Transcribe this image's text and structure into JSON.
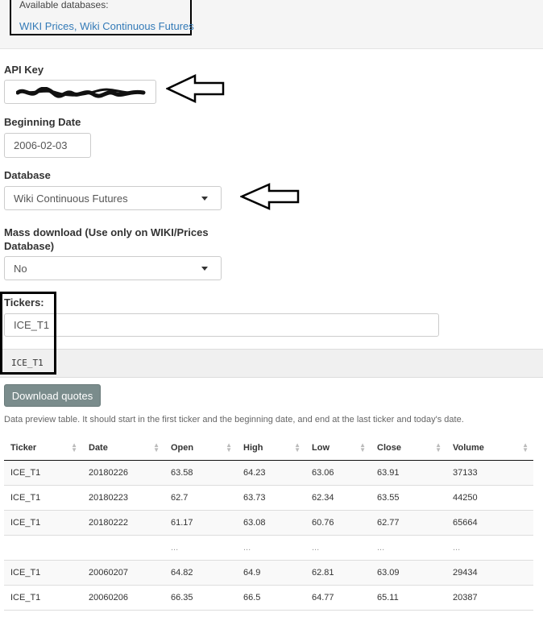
{
  "databases": {
    "title": "Available databases:",
    "list": "WIKI Prices, Wiki Continuous Futures"
  },
  "api_key": {
    "label": "API Key",
    "value_redacted": "redacted-scribble"
  },
  "beginning_date": {
    "label": "Beginning Date",
    "value": "2006-02-03"
  },
  "database": {
    "label": "Database",
    "selected": "Wiki Continuous Futures"
  },
  "mass_download": {
    "label_line1": "Mass download (Use only on WIKI/Prices",
    "label_line2": "Database)",
    "selected": "No"
  },
  "tickers": {
    "label": "Tickers:",
    "input_value": "ICE_T1",
    "token": "ICE_T1"
  },
  "download_button": "Download quotes",
  "preview_note": "Data preview table. It should start in the first ticker and the beginning date, and end at the last ticker and today's date.",
  "table": {
    "headers": [
      "Ticker",
      "Date",
      "Open",
      "High",
      "Low",
      "Close",
      "Volume"
    ],
    "rows": [
      [
        "ICE_T1",
        "20180226",
        "63.58",
        "64.23",
        "63.06",
        "63.91",
        "37133"
      ],
      [
        "ICE_T1",
        "20180223",
        "62.7",
        "63.73",
        "62.34",
        "63.55",
        "44250"
      ],
      [
        "ICE_T1",
        "20180222",
        "61.17",
        "63.08",
        "60.76",
        "62.77",
        "65664"
      ],
      [
        "",
        "",
        "...",
        "...",
        "...",
        "...",
        "..."
      ],
      [
        "ICE_T1",
        "20060207",
        "64.82",
        "64.9",
        "62.81",
        "63.09",
        "29434"
      ],
      [
        "ICE_T1",
        "20060206",
        "66.35",
        "66.5",
        "64.77",
        "65.11",
        "20387"
      ]
    ]
  },
  "colors": {
    "link": "#337ab7",
    "button_bg": "#7a8c8c",
    "annotation": "#000000"
  }
}
